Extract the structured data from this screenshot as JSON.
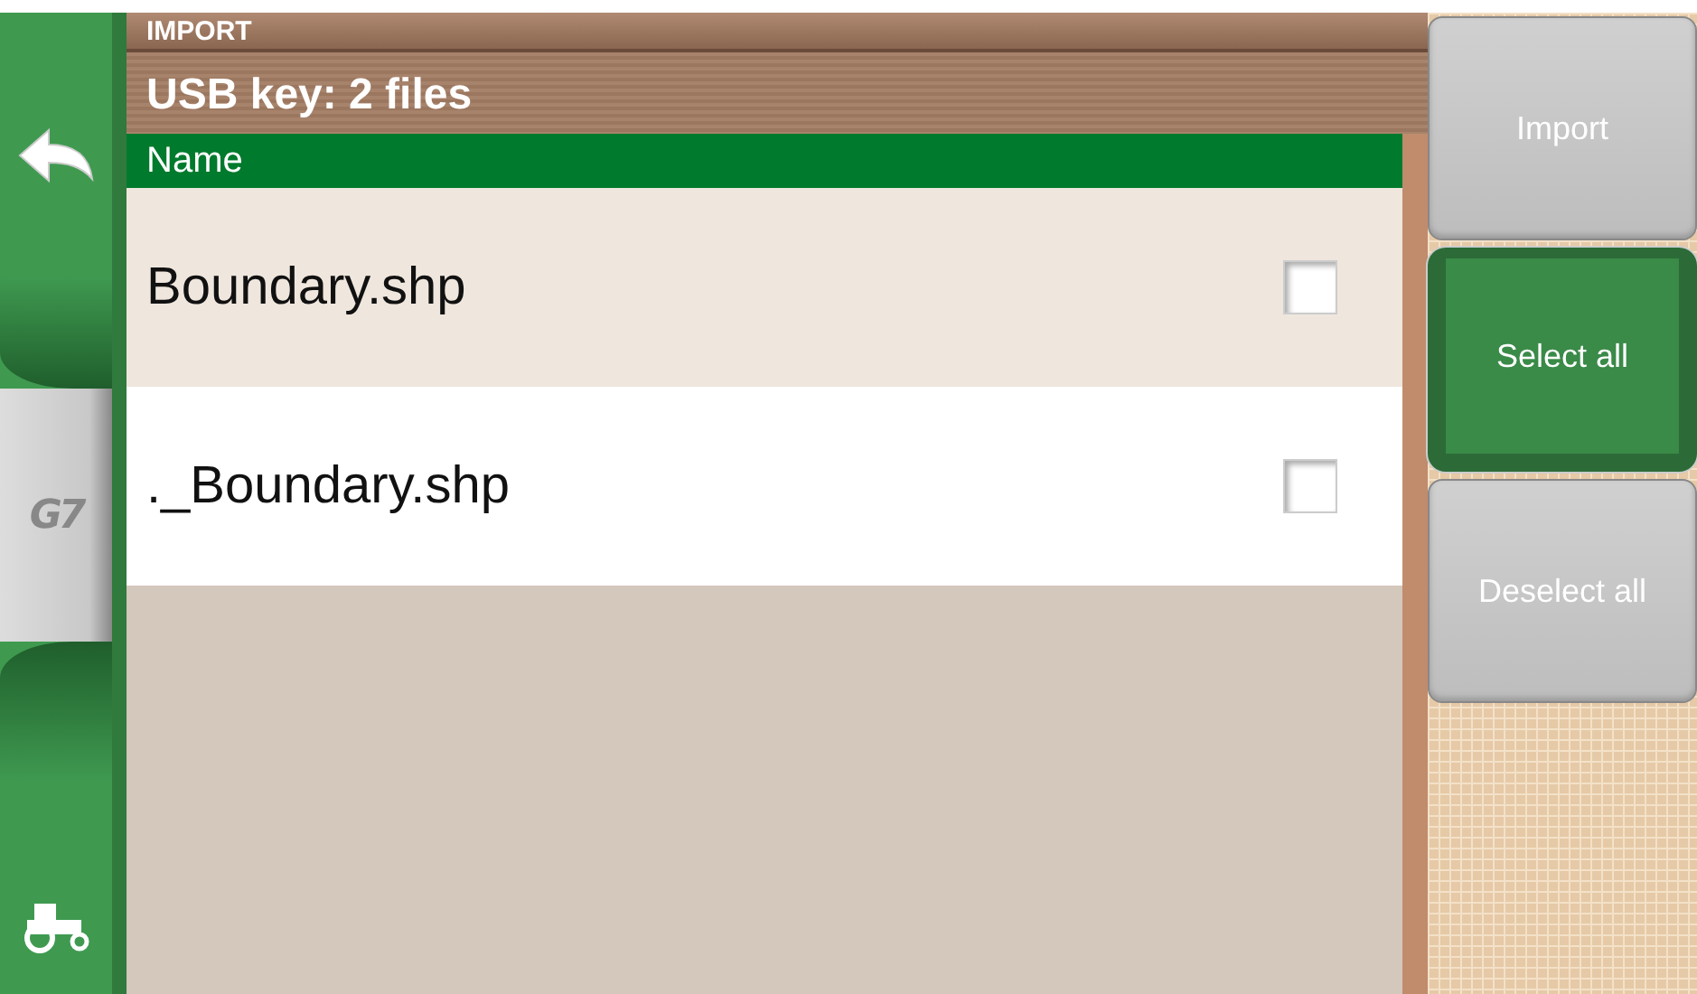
{
  "sidebar": {
    "logo": "G7"
  },
  "header": {
    "section": "IMPORT",
    "title": "USB key: 2 files"
  },
  "table": {
    "columns": [
      "Name"
    ],
    "rows": [
      {
        "name": "Boundary.shp",
        "selected": true,
        "checked": false
      },
      {
        "name": "._Boundary.shp",
        "selected": false,
        "checked": false
      }
    ]
  },
  "buttons": [
    {
      "label": "Import",
      "active": false
    },
    {
      "label": "Select all",
      "active": true
    },
    {
      "label": "Deselect all",
      "active": false
    }
  ]
}
